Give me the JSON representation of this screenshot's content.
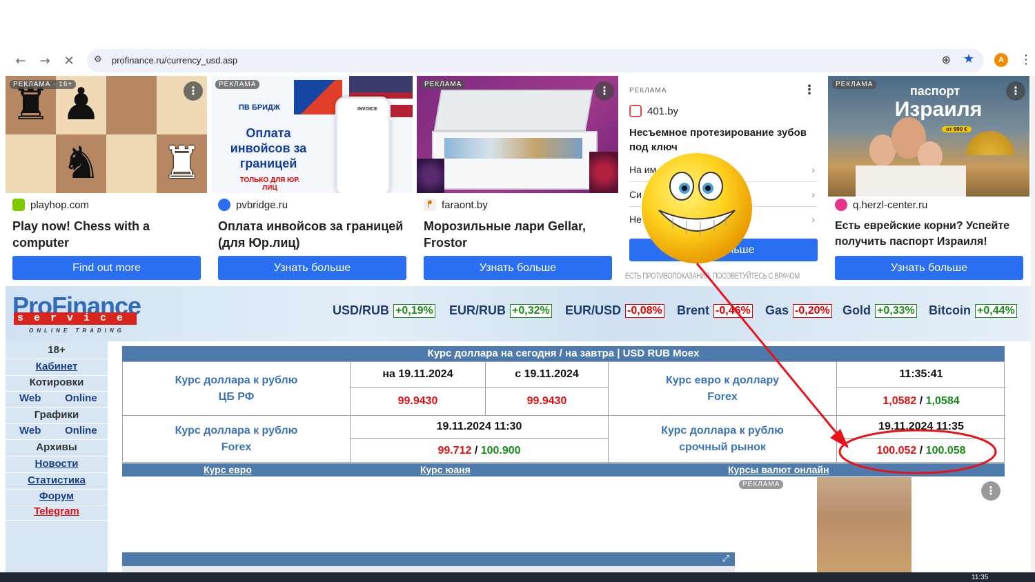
{
  "browser": {
    "url": "profinance.ru/currency_usd.asp",
    "avatar_letter": "A",
    "icons": [
      "back-icon",
      "forward-icon",
      "stop-icon",
      "site-settings-icon",
      "zoom-icon",
      "bookmark-star-icon",
      "menu-icon"
    ]
  },
  "ads": [
    {
      "badge": "РЕКЛАМА · 16+",
      "source": "playhop.com",
      "title": "Play now! Chess with a computer",
      "button": "Find out more"
    },
    {
      "badge": "РЕКЛАМА",
      "source": "pvbridge.ru",
      "title": "Оплата инвойсов за границей (для Юр.лиц)",
      "button": "Узнать больше",
      "img_brand": "ПВ БРИДЖ",
      "img_headline": "Оплата инвойсов за границей",
      "img_sub": "ТОЛЬКО ДЛЯ ЮР. ЛИЦ",
      "img_doc": "INVOICE"
    },
    {
      "badge": "РЕКЛАМА",
      "source": "faraont.by",
      "title": "Морозильные лари Gellar, Frostor",
      "button": "Узнать больше"
    },
    {
      "badge": "РЕКЛАМА",
      "source": "401.by",
      "title": "Несъемное протезирование зубов под ключ",
      "button": "Узнать больше",
      "options": [
        "На им",
        "Си",
        "Не"
      ],
      "button_visible": "льше",
      "disclaimer": "ЕСТЬ ПРОТИВОПОКАЗАНИЯ. ПОСОВЕТУЙТЕСЬ С ВРАЧОМ"
    },
    {
      "badge": "РЕКЛАМА",
      "source": "q.herzl-center.ru",
      "title": "Есть еврейские корни? Успейте получить паспорт Израиля!",
      "button": "Узнать больше",
      "img_line1": "паспорт",
      "img_line2": "Израиля",
      "img_price": "от 990 €"
    }
  ],
  "profinance": {
    "logo_main": "ProFinance",
    "logo_service": "service",
    "logo_tag": "ONLINE TRADING",
    "tickers": [
      {
        "name": "USD/RUB",
        "change": "+0,19%",
        "dir": "up"
      },
      {
        "name": "EUR/RUB",
        "change": "+0,32%",
        "dir": "up"
      },
      {
        "name": "EUR/USD",
        "change": "-0,08%",
        "dir": "down"
      },
      {
        "name": "Brent",
        "change": "-0,46%",
        "dir": "down"
      },
      {
        "name": "Gas",
        "change": "-0,20%",
        "dir": "down"
      },
      {
        "name": "Gold",
        "change": "+0,33%",
        "dir": "up"
      },
      {
        "name": "Bitcoin",
        "change": "+0,44%",
        "dir": "up"
      }
    ]
  },
  "sidebar": {
    "age": "18+",
    "cabinet": "Кабинет",
    "quotes": "Котировки",
    "quotes_web": "Web",
    "quotes_online": "Online",
    "charts": "Графики",
    "charts_web": "Web",
    "charts_online": "Online",
    "archives": "Архивы",
    "news": "Новости",
    "stats": "Статистика",
    "forum": "Форум",
    "telegram": "Telegram"
  },
  "rates": {
    "title": "Курс доллара на сегодня / на завтра | USD RUB Moex",
    "cbr_label_1": "Курс доллара к рублю",
    "cbr_label_2": "ЦБ РФ",
    "date_today": "на 19.11.2024",
    "date_from": "с 19.11.2024",
    "cbr_today": "99.9430",
    "cbr_from": "99.9430",
    "eurusd_label_1": "Курс евро к доллару",
    "eurusd_label_2": "Forex",
    "eurusd_time": "11:35:41",
    "eurusd_bid": "1,0582",
    "eurusd_sep": " / ",
    "eurusd_ask": "1,0584",
    "forex_label_1": "Курс доллара к рублю",
    "forex_label_2": "Forex",
    "forex_time": "19.11.2024 11:30",
    "forex_bid": "99.712",
    "forex_sep": " / ",
    "forex_ask": "100.900",
    "moex_label_1": "Курс доллара к рублю",
    "moex_label_2": "срочный рынок",
    "moex_time": "19.11.2024 11:35",
    "moex_bid": "100.052",
    "moex_sep": " / ",
    "moex_ask": "100.058"
  },
  "links_bar": {
    "euro": "Курс евро",
    "yuan": "Курс юаня",
    "online": "Курсы валют онлайн"
  },
  "bottom_ad": {
    "badge": "РЕКЛАМА"
  },
  "taskbar": {
    "time": "11:35"
  },
  "colors": {
    "accent_blue": "#2a6ff2",
    "header_bar": "#4e7aac",
    "label_blue": "#3c73b6",
    "down_red": "#e01010",
    "up_green": "#168a16",
    "annotation_red": "#e8121a"
  }
}
